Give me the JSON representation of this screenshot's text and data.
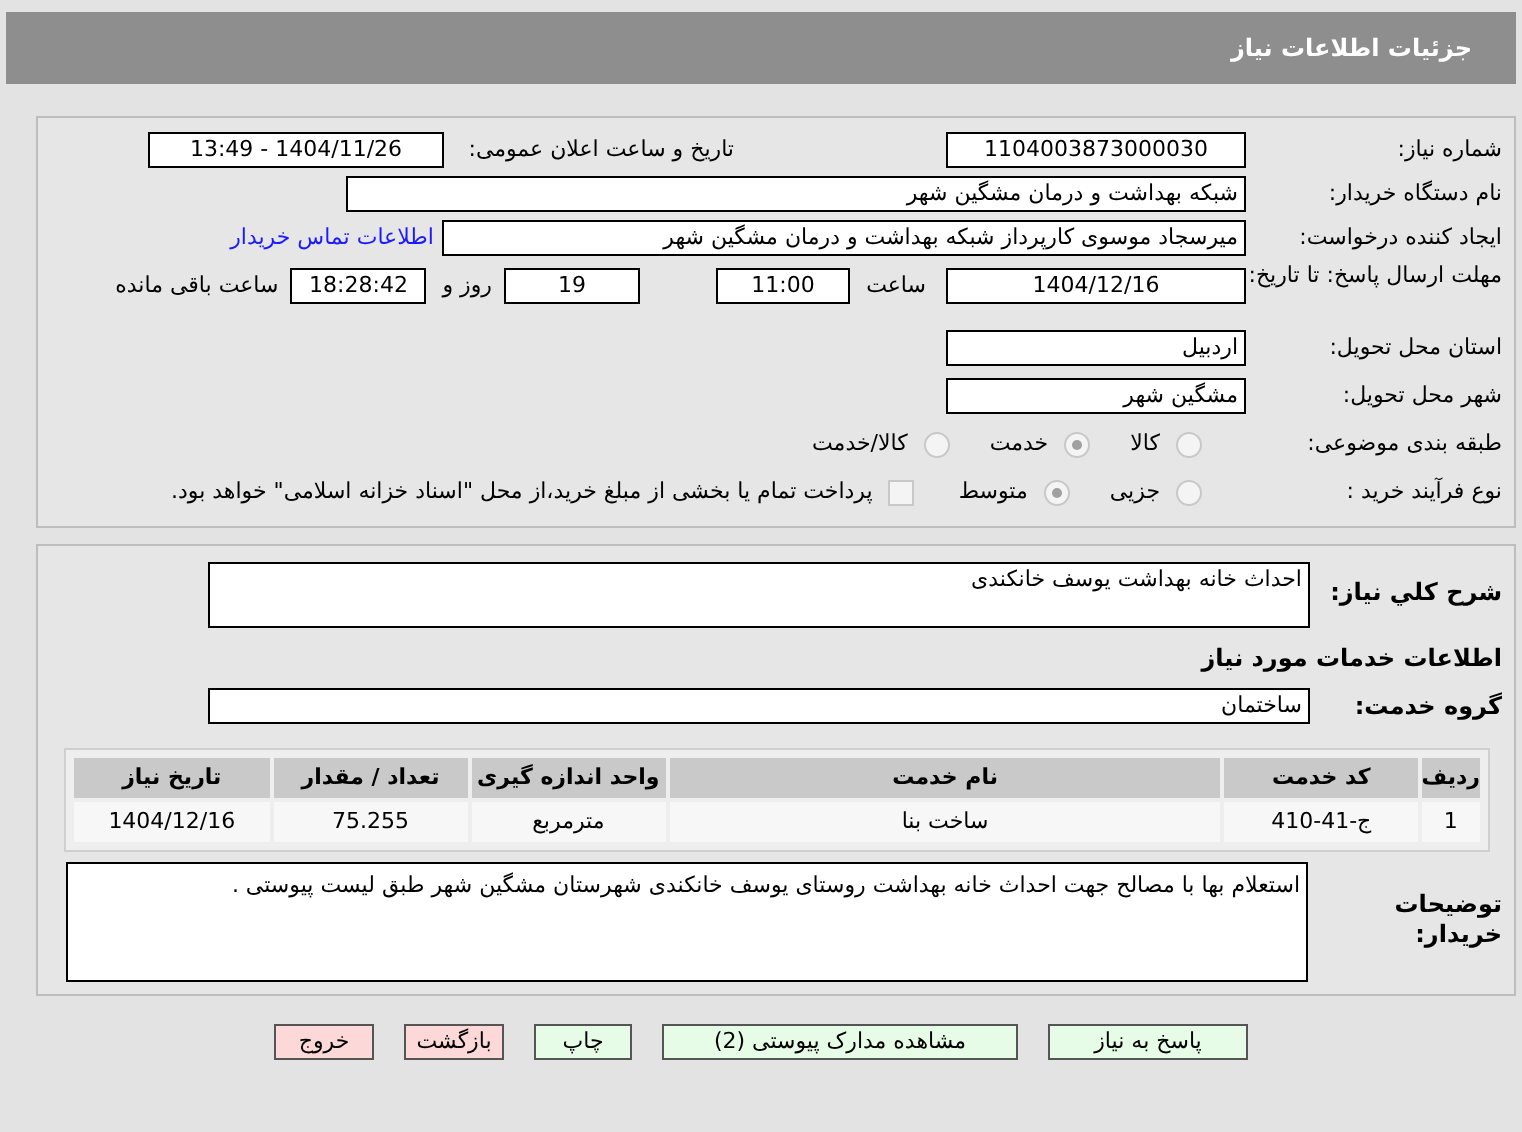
{
  "window": {
    "title": "جزئیات اطلاعات نیاز"
  },
  "details": {
    "need_number": {
      "label": "شماره نیاز:",
      "value": "1104003873000030"
    },
    "announce": {
      "label": "تاریخ و ساعت اعلان عمومی:",
      "value": "1404/11/26 - 13:49"
    },
    "buyer": {
      "label": "نام دستگاه خریدار:",
      "value": "شبکه بهداشت و درمان مشگین شهر"
    },
    "creator": {
      "label": "ایجاد کننده درخواست:",
      "value": "میرسجاد موسوی کارپرداز شبکه بهداشت و درمان مشگین شهر",
      "link": "اطلاعات تماس خریدار"
    },
    "deadline": {
      "label": "مهلت ارسال پاسخ: تا تاریخ:",
      "date": "1404/12/16",
      "time_label": "ساعت",
      "time": "11:00",
      "days": "19",
      "days_label": "روز و",
      "remaining": "18:28:42",
      "remaining_label": "ساعت باقی مانده"
    },
    "province": {
      "label": "استان محل تحویل:",
      "value": "اردبیل"
    },
    "city": {
      "label": "شهر محل تحویل:",
      "value": "مشگین شهر"
    },
    "category": {
      "label": "طبقه بندی موضوعی:",
      "options": [
        {
          "label": "کالا",
          "selected": false
        },
        {
          "label": "خدمت",
          "selected": true
        },
        {
          "label": "کالا/خدمت",
          "selected": false
        }
      ]
    },
    "process": {
      "label": "نوع فرآیند خرید :",
      "options": [
        {
          "label": "جزیی",
          "selected": false
        },
        {
          "label": "متوسط",
          "selected": true
        }
      ],
      "treasury": {
        "label": "پرداخت تمام یا بخشی از مبلغ خرید،از محل \"اسناد خزانه اسلامی\" خواهد بود.",
        "checked": false
      }
    }
  },
  "summary": {
    "label": "شرح کلي نياز:",
    "value": "احداث خانه بهداشت یوسف خانکندی"
  },
  "services_title": "اطلاعات خدمات مورد نیاز",
  "service_group": {
    "label": "گروه خدمت:",
    "value": "ساختمان"
  },
  "table": {
    "columns": [
      "ردیف",
      "کد خدمت",
      "نام خدمت",
      "واحد اندازه گیری",
      "تعداد / مقدار",
      "تاریخ نیاز"
    ],
    "rows": [
      [
        "1",
        "ج-41-410",
        "ساخت بنا",
        "مترمربع",
        "75.255",
        "1404/12/16"
      ]
    ]
  },
  "notes": {
    "label": "توضیحات خریدار:",
    "value": "استعلام بها با مصالح جهت احداث خانه بهداشت روستای یوسف خانکندی شهرستان مشگین شهر طبق لیست پیوستی ."
  },
  "buttons": [
    {
      "label": "پاسخ به نیاز",
      "kind": "normal"
    },
    {
      "label": "مشاهده مدارک پیوستی (2)",
      "kind": "normal"
    },
    {
      "label": "چاپ",
      "kind": "normal"
    },
    {
      "label": "بازگشت",
      "kind": "danger"
    },
    {
      "label": "خروج",
      "kind": "danger"
    }
  ]
}
